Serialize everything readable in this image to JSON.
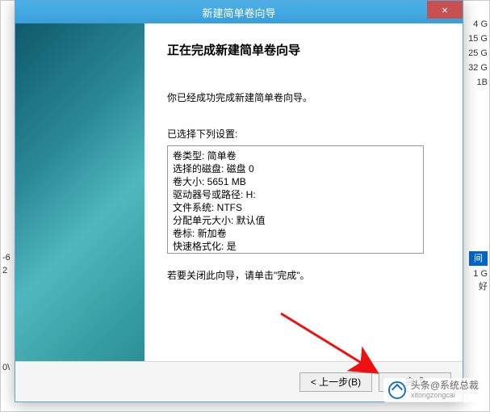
{
  "dialog": {
    "title": "新建简单卷向导",
    "heading": "正在完成新建简单卷向导",
    "intro": "你已经成功完成新建简单卷向导。",
    "settings_label": "已选择下列设置:",
    "settings_lines": [
      "卷类型: 简单卷",
      "选择的磁盘: 磁盘 0",
      "卷大小: 5651 MB",
      "驱动器号或路径: H:",
      "文件系统: NTFS",
      "分配单元大小: 默认值",
      "卷标: 新加卷",
      "快速格式化: 是"
    ],
    "closing": "若要关闭此向导，请单击\"完成\"。",
    "buttons": {
      "back": "< 上一步(B)",
      "finish": "完成"
    },
    "close_icon": "×"
  },
  "background": {
    "right_top": [
      "4 G",
      "15 G",
      "25 G",
      "32 G",
      "1B"
    ],
    "left_mid": [
      "-6",
      "2"
    ],
    "right_mid_header": "间",
    "right_mid_rows": [
      "1 G",
      "好"
    ],
    "bottom_left": "0\\"
  },
  "watermark": {
    "main": "头条@系统总裁",
    "sub": "xitongzongcai"
  }
}
